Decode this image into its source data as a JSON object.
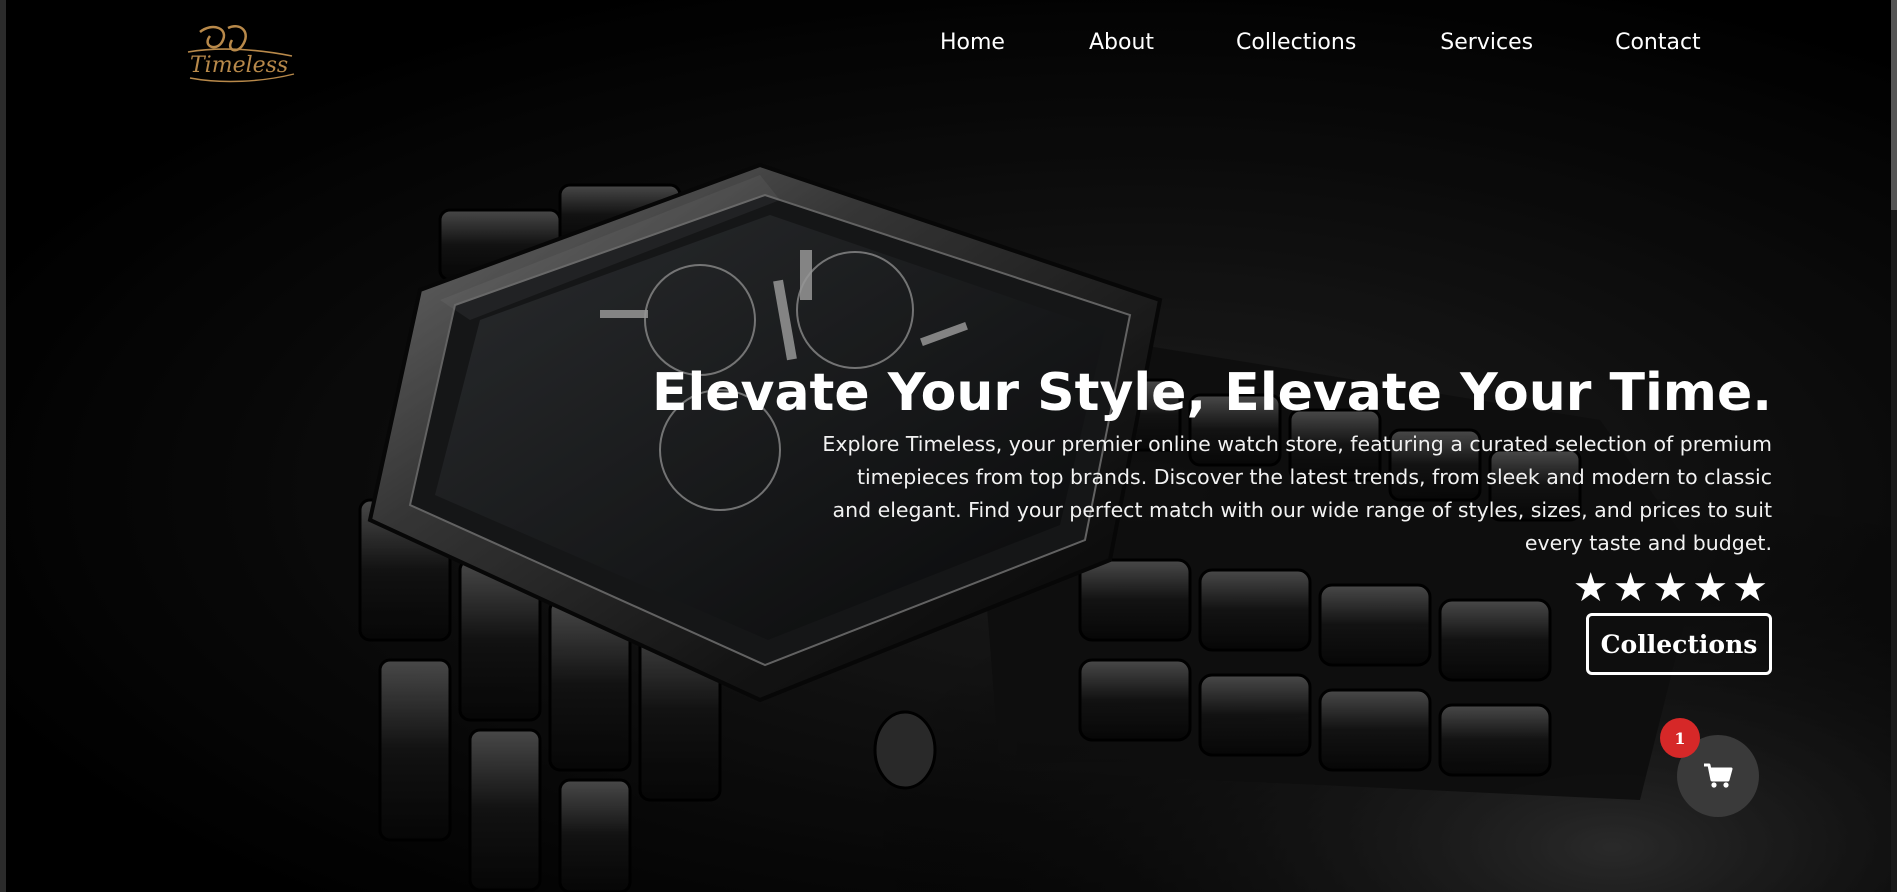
{
  "brand": {
    "logo_text": "Timeless"
  },
  "nav": {
    "items": [
      {
        "label": "Home"
      },
      {
        "label": "About"
      },
      {
        "label": "Collections"
      },
      {
        "label": "Services"
      },
      {
        "label": "Contact"
      }
    ]
  },
  "hero": {
    "title": "Elevate Your Style, Elevate Your Time.",
    "description": "Explore Timeless, your premier online watch store, featuring a curated selection of premium timepieces from top brands. Discover the latest trends, from sleek and modern to classic and elegant. Find your perfect match with our wide range of styles, sizes, and prices to suit every taste and budget.",
    "rating": 5,
    "rating_stars": "★★★★★",
    "cta_label": "Collections"
  },
  "cart": {
    "count": "1",
    "icon": "cart-icon"
  },
  "colors": {
    "background": "#000000",
    "badge": "#d62828",
    "cart_button": "#3a3a3a",
    "logo_gold": "#b8894a"
  }
}
